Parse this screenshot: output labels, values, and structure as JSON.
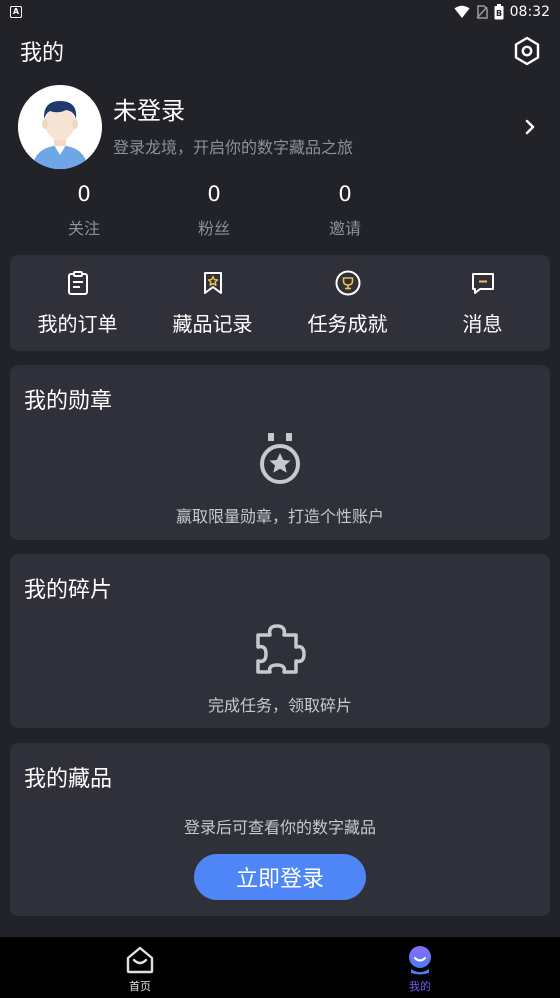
{
  "status_bar": {
    "notification_badge": "A",
    "time": "08:32",
    "battery_label": "B"
  },
  "header": {
    "title": "我的",
    "settings_icon": "gear-hexagon-icon"
  },
  "profile": {
    "name": "未登录",
    "subtitle": "登录龙境，开启你的数字藏品之旅",
    "avatar_icon": "default-avatar-icon"
  },
  "stats": [
    {
      "value": "0",
      "label": "关注"
    },
    {
      "value": "0",
      "label": "粉丝"
    },
    {
      "value": "0",
      "label": "邀请"
    }
  ],
  "quick_actions": [
    {
      "label": "我的订单",
      "icon": "clipboard-icon"
    },
    {
      "label": "藏品记录",
      "icon": "bookmark-star-icon"
    },
    {
      "label": "任务成就",
      "icon": "trophy-icon"
    },
    {
      "label": "消息",
      "icon": "message-icon"
    }
  ],
  "medals": {
    "title": "我的勋章",
    "description": "赢取限量勋章，打造个性账户",
    "icon": "medal-icon"
  },
  "fragments": {
    "title": "我的碎片",
    "description": "完成任务，领取碎片",
    "icon": "puzzle-icon"
  },
  "collections": {
    "title": "我的藏品",
    "description": "登录后可查看你的数字藏品",
    "button": "立即登录"
  },
  "tabbar": {
    "items": [
      {
        "label": "首页",
        "icon": "home-icon",
        "active": false
      },
      {
        "label": "我的",
        "icon": "profile-icon",
        "active": true
      }
    ],
    "active_color": "#6b5cf0",
    "inactive_color": "#e0e0e0"
  },
  "colors": {
    "background": "#222229",
    "card": "#30303a",
    "accent": "#4f86f7",
    "muted_text": "#8f8f99"
  }
}
